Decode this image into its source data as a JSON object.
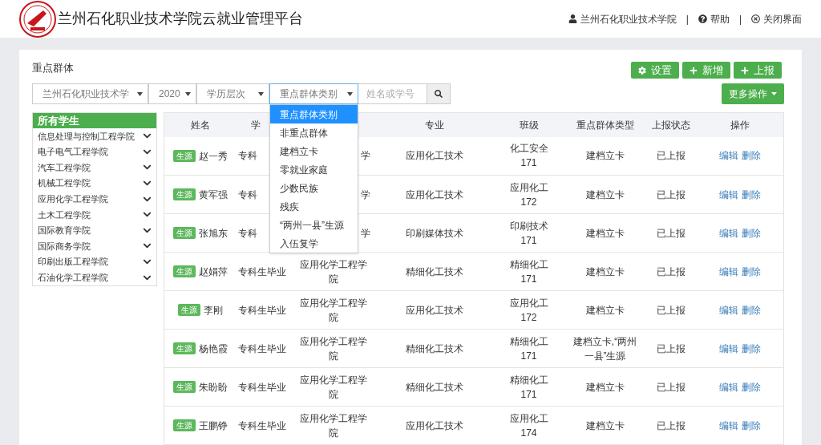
{
  "header": {
    "title": "兰州石化职业技术学院云就业管理平台",
    "user": "兰州石化职业技术学院",
    "help": "帮助",
    "close": "关闭界面",
    "separators": [
      "|",
      "|"
    ]
  },
  "panel": {
    "title": "重点群体",
    "buttons": [
      {
        "kind": "gear",
        "label": "设置"
      },
      {
        "kind": "plus",
        "label": "新增"
      },
      {
        "kind": "plus",
        "label": "上报"
      }
    ],
    "more": "更多操作"
  },
  "filters": {
    "selects": [
      {
        "value": "兰州石化职业技术学",
        "focused": false
      },
      {
        "value": "2020",
        "focused": false
      },
      {
        "value": "学历层次",
        "focused": false
      },
      {
        "value": "重点群体类别",
        "focused": true,
        "options": [
          {
            "label": "重点群体类别",
            "selected": true
          },
          {
            "label": "非重点群体",
            "selected": false
          },
          {
            "label": "建档立卡",
            "selected": false
          },
          {
            "label": "零就业家庭",
            "selected": false
          },
          {
            "label": "少数民族",
            "selected": false
          },
          {
            "label": "残疾",
            "selected": false
          },
          {
            "label": "“两州一县”生源",
            "selected": false
          },
          {
            "label": "入伍复学",
            "selected": false
          }
        ]
      }
    ],
    "search": {
      "placeholder": "姓名或学号"
    }
  },
  "sidebar": {
    "header": "所有学生",
    "items": [
      {
        "label": "信息处理与控制工程学院",
        "expanded": false
      },
      {
        "label": "电子电气工程学院",
        "expanded": false
      },
      {
        "label": "汽车工程学院",
        "expanded": false
      },
      {
        "label": "机械工程学院",
        "expanded": false
      },
      {
        "label": "应用化学工程学院",
        "expanded": false
      },
      {
        "label": "土木工程学院",
        "expanded": false
      },
      {
        "label": "国际教育学院",
        "expanded": false
      },
      {
        "label": "国际商务学院",
        "expanded": false
      },
      {
        "label": "印刷出版工程学院",
        "expanded": false
      },
      {
        "label": "石油化学工程学院",
        "expanded": false
      }
    ]
  },
  "table": {
    "columns": [
      {
        "label": "姓名"
      },
      {
        "label": "学"
      },
      {},
      {
        "label": "专业"
      },
      {
        "label": "班级"
      },
      {
        "label": "重点群体类型"
      },
      {
        "label": "上报状态"
      },
      {
        "label": "操作"
      }
    ],
    "rows": [
      {
        "tag": "生源",
        "name": "赵一秀",
        "level": "专科",
        "college": "学",
        "major": "应用化工技术",
        "class": "化工安全171",
        "group_type": "建档立卡",
        "status": "已上报",
        "actions": [
          "编辑",
          "删除"
        ]
      },
      {
        "tag": "生源",
        "name": "黄军强",
        "level": "专科",
        "college": "学",
        "major": "应用化工技术",
        "class": "应用化工172",
        "group_type": "建档立卡",
        "status": "已上报",
        "actions": [
          "编辑",
          "删除"
        ]
      },
      {
        "tag": "生源",
        "name": "张旭东",
        "level": "专科",
        "college": "学",
        "major": "印刷媒体技术",
        "class": "印刷技术171",
        "group_type": "建档立卡",
        "status": "已上报",
        "actions": [
          "编辑",
          "删除"
        ]
      },
      {
        "tag": "生源",
        "name": "赵娟萍",
        "level": "专科生毕业",
        "college": "应用化学工程学院",
        "major": "精细化工技术",
        "class": "精细化工171",
        "group_type": "建档立卡",
        "status": "已上报",
        "actions": [
          "编辑",
          "删除"
        ]
      },
      {
        "tag": "生源",
        "name": "李刚",
        "level": "专科生毕业",
        "college": "应用化学工程学院",
        "major": "应用化工技术",
        "class": "应用化工172",
        "group_type": "建档立卡",
        "status": "已上报",
        "actions": [
          "编辑",
          "删除"
        ]
      },
      {
        "tag": "生源",
        "name": "杨艳霞",
        "level": "专科生毕业",
        "college": "应用化学工程学院",
        "major": "精细化工技术",
        "class": "精细化工171",
        "group_type": "建档立卡,“两州一县”生源",
        "status": "已上报",
        "actions": [
          "编辑",
          "删除"
        ]
      },
      {
        "tag": "生源",
        "name": "朱盼盼",
        "level": "专科生毕业",
        "college": "应用化学工程学院",
        "major": "精细化工技术",
        "class": "精细化工171",
        "group_type": "建档立卡",
        "status": "已上报",
        "actions": [
          "编辑",
          "删除"
        ]
      },
      {
        "tag": "生源",
        "name": "王鹏铮",
        "level": "专科生毕业",
        "college": "应用化学工程学院",
        "major": "应用化工技术",
        "class": "应用化工174",
        "group_type": "建档立卡",
        "status": "已上报",
        "actions": [
          "编辑",
          "删除"
        ]
      }
    ]
  }
}
